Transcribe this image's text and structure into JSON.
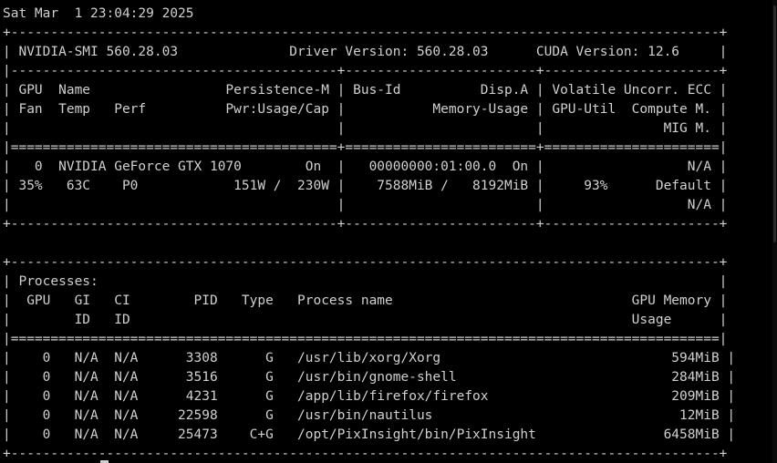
{
  "terminal": {
    "lines": [
      "Sat Mar  1 23:04:29 2025",
      "+-----------------------------------------------------------------------------------------+",
      "| NVIDIA-SMI 560.28.03              Driver Version: 560.28.03      CUDA Version: 12.6     |",
      "|-----------------------------------------+------------------------+----------------------+",
      "| GPU  Name                 Persistence-M | Bus-Id          Disp.A | Volatile Uncorr. ECC |",
      "| Fan  Temp   Perf          Pwr:Usage/Cap |           Memory-Usage | GPU-Util  Compute M. |",
      "|                                         |                        |               MIG M. |",
      "|=========================================+========================+======================|",
      "|   0  NVIDIA GeForce GTX 1070        On  |   00000000:01:00.0  On |                  N/A |",
      "| 35%   63C    P0            151W /  230W |    7588MiB /   8192MiB |     93%      Default |",
      "|                                         |                        |                  N/A |",
      "+-----------------------------------------+------------------------+----------------------+",
      "",
      "+-----------------------------------------------------------------------------------------+",
      "| Processes:                                                                              |",
      "|  GPU   GI   CI        PID   Type   Process name                              GPU Memory |",
      "|        ID   ID                                                               Usage      |",
      "|=========================================================================================|",
      "|    0   N/A  N/A      3308      G   /usr/lib/xorg/Xorg                             594MiB |",
      "|    0   N/A  N/A      3516      G   /usr/bin/gnome-shell                           284MiB |",
      "|    0   N/A  N/A      4231      G   /app/lib/firefox/firefox                       209MiB |",
      "|    0   N/A  N/A     22598      G   /usr/bin/nautilus                               12MiB |",
      "|    0   N/A  N/A     25473    C+G   /opt/PixInsight/bin/PixInsight                6458MiB |",
      "+-----------------------------------------------------------------------------------------+"
    ]
  },
  "colors": {
    "background": "#000000",
    "foreground": "#d0d0d0"
  }
}
